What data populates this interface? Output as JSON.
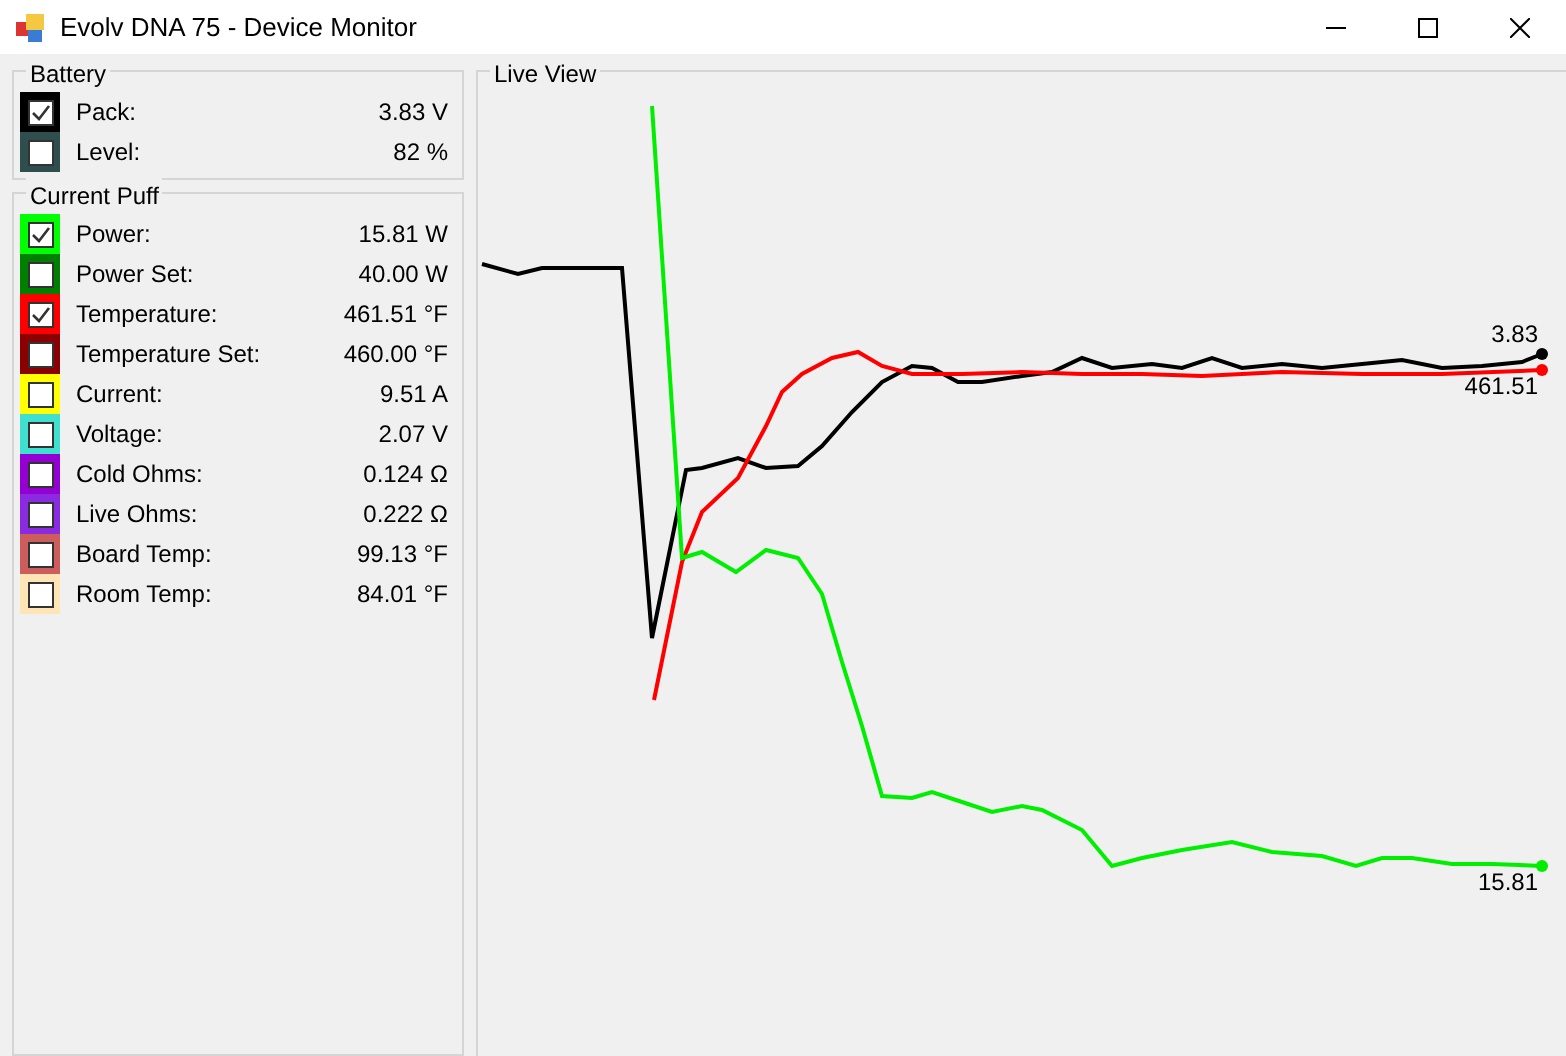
{
  "window": {
    "title": "Evolv DNA 75 - Device Monitor"
  },
  "battery": {
    "title": "Battery",
    "items": [
      {
        "label": "Pack:",
        "value": "3.83 V",
        "color": "#000000",
        "checked": true
      },
      {
        "label": "Level:",
        "value": "82 %",
        "color": "#2f4f4f",
        "checked": false
      }
    ]
  },
  "current_puff": {
    "title": "Current Puff",
    "items": [
      {
        "label": "Power:",
        "value": "15.81 W",
        "color": "#00ff00",
        "checked": true
      },
      {
        "label": "Power Set:",
        "value": "40.00 W",
        "color": "#008000",
        "checked": false
      },
      {
        "label": "Temperature:",
        "value": "461.51 °F",
        "color": "#ff0000",
        "checked": true
      },
      {
        "label": "Temperature Set:",
        "value": "460.00 °F",
        "color": "#8b0000",
        "checked": false
      },
      {
        "label": "Current:",
        "value": "9.51 A",
        "color": "#ffff00",
        "checked": false
      },
      {
        "label": "Voltage:",
        "value": "2.07 V",
        "color": "#40e0d0",
        "checked": false
      },
      {
        "label": "Cold Ohms:",
        "value": "0.124 Ω",
        "color": "#9400d3",
        "checked": false
      },
      {
        "label": "Live Ohms:",
        "value": "0.222 Ω",
        "color": "#8a2be2",
        "checked": false
      },
      {
        "label": "Board Temp:",
        "value": "99.13 °F",
        "color": "#cd5c5c",
        "checked": false
      },
      {
        "label": "Room Temp:",
        "value": "84.01 °F",
        "color": "#ffe4b5",
        "checked": false
      }
    ]
  },
  "live_view": {
    "title": "Live View",
    "end_labels": [
      "3.83",
      "461.51",
      "15.81"
    ]
  }
}
